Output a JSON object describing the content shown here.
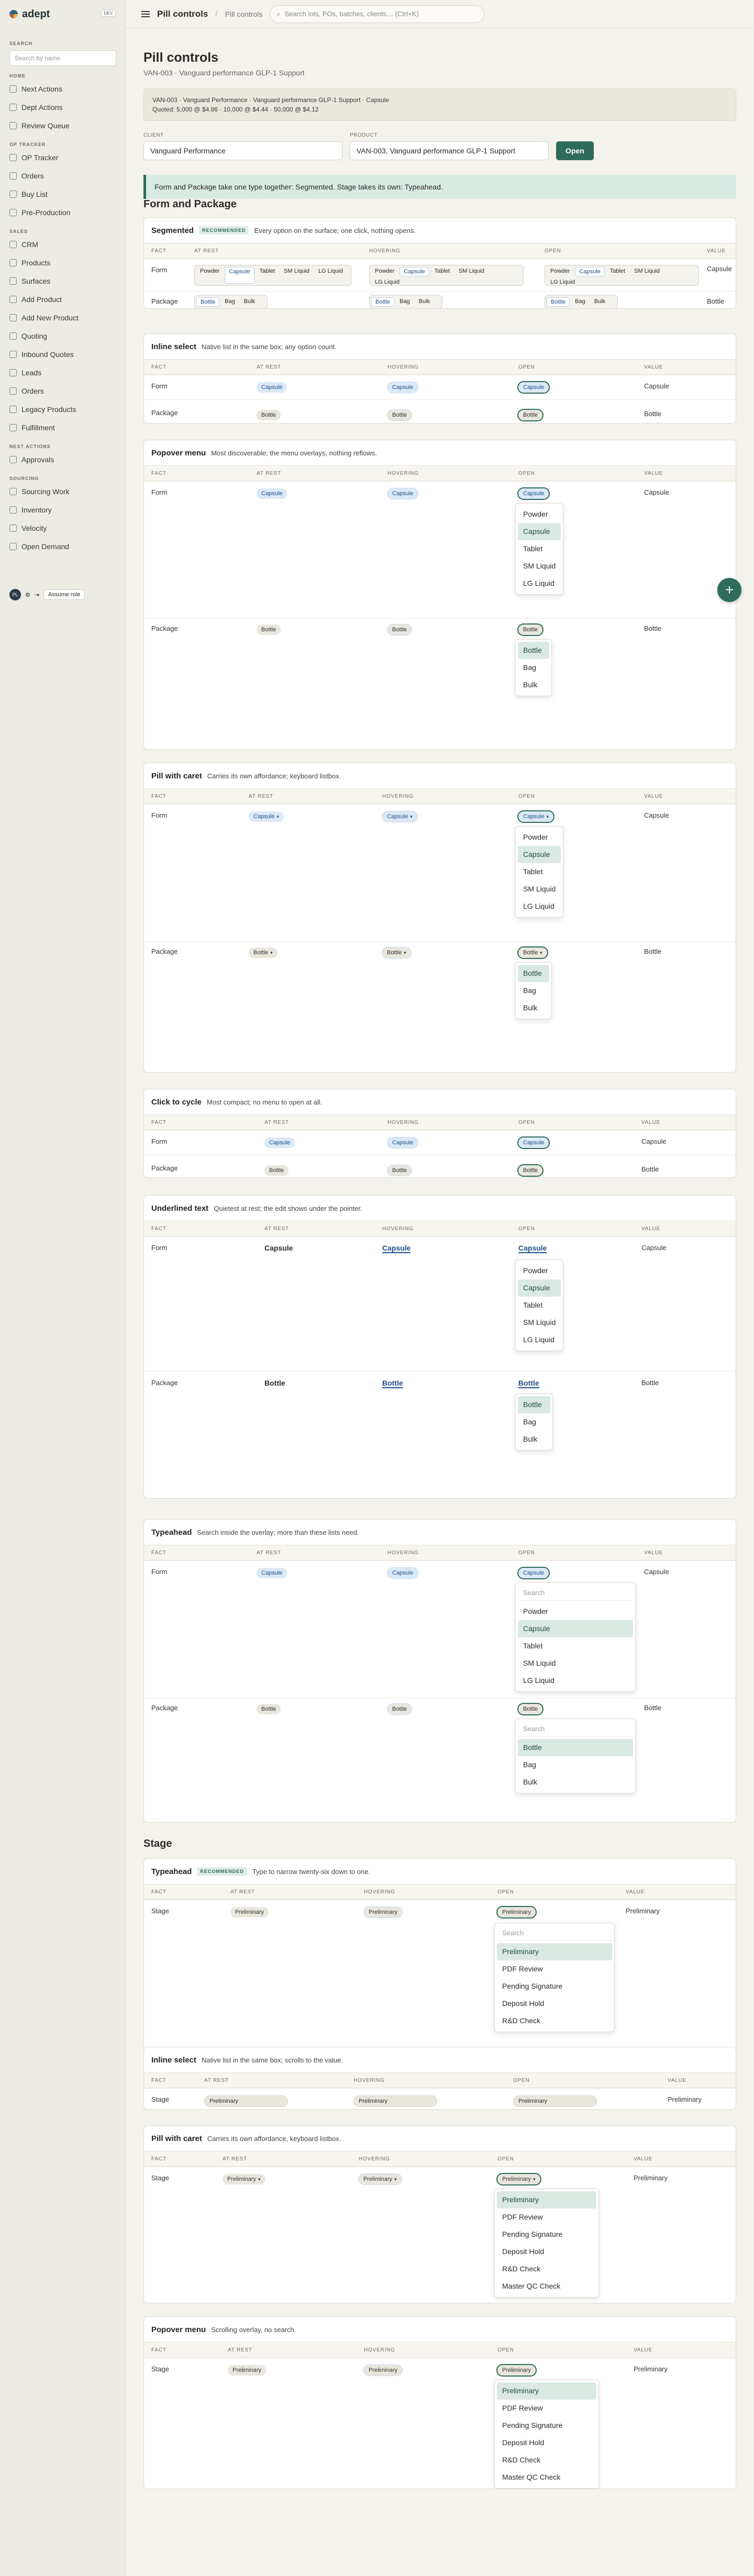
{
  "brand": {
    "name": "adept",
    "env": "DEV"
  },
  "sidebar": {
    "search_label": "SEARCH",
    "search_placeholder": "Search by name",
    "groups": [
      {
        "label": "HOME",
        "items": [
          "Next Actions",
          "Dept Actions",
          "Review Queue"
        ]
      },
      {
        "label": "OP TRACKER",
        "items": [
          "OP Tracker",
          "Orders",
          "Buy List",
          "Pre-Production"
        ]
      },
      {
        "label": "SALES",
        "items": [
          "CRM",
          "Products",
          "Surfaces",
          "Add Product",
          "Add New Product",
          "Quoting",
          "Inbound Quotes",
          "Leads",
          "Orders",
          "Legacy Products",
          "Fulfillment"
        ]
      },
      {
        "label": "NEXT ACTIONS",
        "items": [
          "Approvals"
        ]
      },
      {
        "label": "SOURCING",
        "items": [
          "Sourcing Work",
          "Inventory",
          "Velocity",
          "Open Demand"
        ]
      }
    ],
    "footer": {
      "avatar": "PL",
      "assume_label": "Assume role"
    }
  },
  "topbar": {
    "title": "Pill controls",
    "subtitle": "Pill controls",
    "search_placeholder": "Search lots, POs, batches, clients… (Ctrl+K)"
  },
  "page": {
    "title": "Pill controls",
    "subtitle": "VAN-003 · Vanguard performance GLP-1 Support",
    "context_line1": "VAN-003 · Vanguard Performance · Vanguard performance GLP-1 Support · Capsule",
    "context_line2": "Quoted: 5,000 @ $4.86 · 10,000 @ $4.44 · 50,000 @ $4.12",
    "client_label": "CLIENT",
    "client_value": "Vanguard Performance",
    "product_label": "PRODUCT",
    "product_value": "VAN-003, Vanguard performance GLP-1 Support",
    "open_label": "Open",
    "banner": "Form and Package take one type together: Segmented. Stage takes its own: Typeahead."
  },
  "columns": {
    "fact": "FACT",
    "rest": "AT REST",
    "hover": "HOVERING",
    "open": "OPEN",
    "value": "VALUE"
  },
  "form_package": {
    "title": "Form and Package",
    "form_label": "Form",
    "package_label": "Package",
    "form_value": "Capsule",
    "package_value": "Bottle",
    "form_options": [
      "Powder",
      "Capsule",
      "Tablet",
      "SM Liquid",
      "LG Liquid"
    ],
    "package_options": [
      "Bottle",
      "Bag",
      "Bulk"
    ],
    "search_placeholder": "Search",
    "recommended": "RECOMMENDED",
    "cards": [
      {
        "title": "Segmented",
        "desc": "Every option on the surface; one click, nothing opens."
      },
      {
        "title": "Inline select",
        "desc": "Native list in the same box; any option count."
      },
      {
        "title": "Popover menu",
        "desc": "Most discoverable; the menu overlays, nothing reflows."
      },
      {
        "title": "Pill with caret",
        "desc": "Carries its own affordance; keyboard listbox."
      },
      {
        "title": "Click to cycle",
        "desc": "Most compact; no menu to open at all."
      },
      {
        "title": "Underlined text",
        "desc": "Quietest at rest; the edit shows under the pointer."
      },
      {
        "title": "Typeahead",
        "desc": "Search inside the overlay; more than these lists need."
      }
    ]
  },
  "stage": {
    "title": "Stage",
    "label": "Stage",
    "value": "Preliminary",
    "options": [
      "Preliminary",
      "PDF Review",
      "Pending Signature",
      "Deposit Hold",
      "R&D Check",
      "Master QC Check"
    ],
    "cards": [
      {
        "title": "Typeahead",
        "desc": "Type to narrow twenty-six down to one."
      },
      {
        "title": "Inline select",
        "desc": "Native list in the same box; scrolls to the value."
      },
      {
        "title": "Pill with caret",
        "desc": "Carries its own affordance, keyboard listbox."
      },
      {
        "title": "Popover menu",
        "desc": "Scrolling overlay, no search."
      }
    ]
  }
}
